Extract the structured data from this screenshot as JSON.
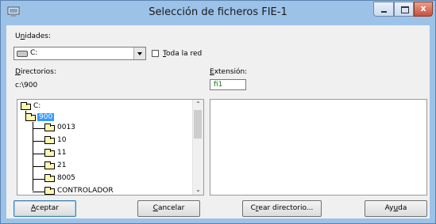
{
  "window": {
    "title": "Selección de ficheros FIE-1",
    "close_glyph": "x"
  },
  "drives": {
    "label_pre": "U",
    "label_u": "n",
    "label_post": "idades:",
    "selected": "C:"
  },
  "network": {
    "label_u": "T",
    "label_post": "oda la red",
    "checked": false
  },
  "directories": {
    "label_u": "D",
    "label_post": "irectorios:",
    "current_path": "c:\\900",
    "tree": [
      {
        "name": "C:",
        "state": "open"
      },
      {
        "name": "900",
        "state": "open-selected"
      },
      {
        "name": "0013",
        "state": "closed"
      },
      {
        "name": "10",
        "state": "closed"
      },
      {
        "name": "11",
        "state": "closed"
      },
      {
        "name": "21",
        "state": "closed"
      },
      {
        "name": "8005",
        "state": "closed"
      },
      {
        "name": "CONTROLADOR",
        "state": "closed"
      }
    ]
  },
  "extension": {
    "label_u": "E",
    "label_post": "xtensión:",
    "value": "fi1"
  },
  "buttons": {
    "accept_u": "A",
    "accept_post": "ceptar",
    "cancel_u": "C",
    "cancel_post": "ancelar",
    "create_pre": "C",
    "create_u": "r",
    "create_post": "ear directorio...",
    "help_pre": "Ay",
    "help_u": "u",
    "help_post": "da"
  },
  "icons": [
    "app-icon",
    "minimize-icon",
    "maximize-icon",
    "close-icon",
    "drive-icon",
    "combo-arrow-icon",
    "folder-icon",
    "scroll-up-icon",
    "scroll-down-icon"
  ]
}
